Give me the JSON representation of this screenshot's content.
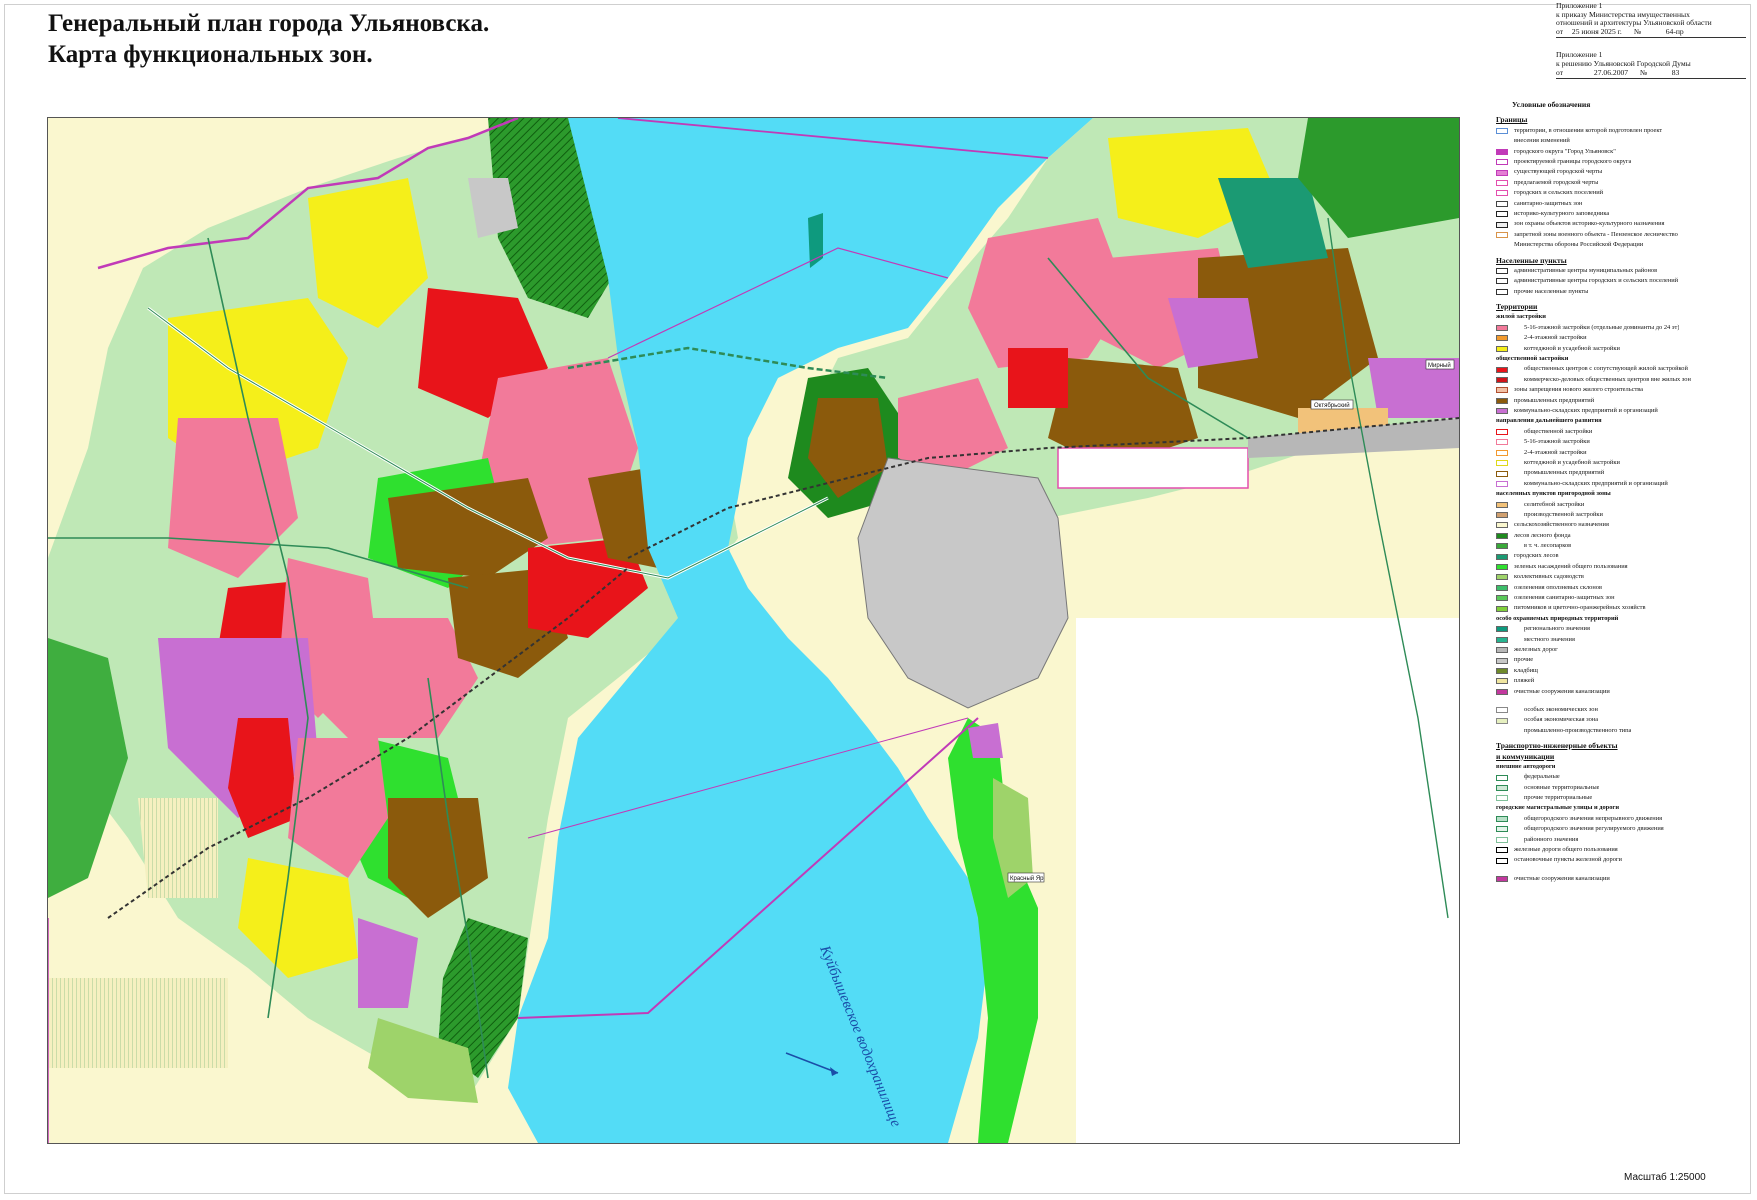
{
  "title": {
    "line1": "Генеральный план города Ульяновска.",
    "line2": "Карта функциональных зон."
  },
  "attachments": [
    {
      "lines": [
        "Приложение 1",
        "к приказу Министерства имущественных",
        "отношений и архитектуры Ульяновской области"
      ],
      "sig_from": "от",
      "sig_date": "25 июня 2025 г.",
      "sig_no": "№",
      "sig_num": "64-пр"
    },
    {
      "lines": [
        "Приложение 1",
        "к решению Ульяновской Городской Думы"
      ],
      "sig_from": "от",
      "sig_date": "27.06.2007",
      "sig_no": "№",
      "sig_num": "83"
    }
  ],
  "legend": {
    "title": "Условные обозначения",
    "sections": [
      {
        "header": "Границы",
        "items": [
          {
            "label": "территории, в отношении которой подготовлен проект",
            "color": "#ffffff",
            "border": "#5b8fd6"
          },
          {
            "label": "внесения изменений",
            "color": null
          },
          {
            "label": "городского округа \"Город Ульяновск\"",
            "color": "#c13ab8",
            "border": "#c13ab8"
          },
          {
            "label": "проектируемой границы городского округа",
            "color": "#ffffff",
            "border": "#c13ab8"
          },
          {
            "label": "существующей городской черты",
            "color": "#e47fd4",
            "border": "#c13ab8"
          },
          {
            "label": "предлагаемой городской черты",
            "color": "#ffffff",
            "border": "#e34fae"
          },
          {
            "label": "городских и сельских поселений",
            "color": "#ffffff",
            "border": "#e34fae"
          },
          {
            "label": "санитарно-защитных зон",
            "color": "#ffffff",
            "border": "#444444"
          },
          {
            "label": "историко-культурного заповедника",
            "color": "#ffffff",
            "border": "#222222"
          },
          {
            "label": "зон охраны объектов историко-культурного назначения",
            "color": "#eeeeee",
            "border": "#222222"
          },
          {
            "label": "запретной зоны военного объекта - Пензенское лесничество",
            "color": "#ffffff",
            "border": "#d8944a"
          },
          {
            "label": "Министерства обороны Российской Федерации",
            "color": null
          }
        ]
      },
      {
        "header": "Населенные пункты",
        "items": [
          {
            "label": "административные центры муниципальных районов",
            "color": "#ffffff",
            "border": "#333333"
          },
          {
            "label": "административные центры городских и сельских поселений",
            "color": "#ffffff",
            "border": "#333333"
          },
          {
            "label": "прочие населенные пункты",
            "color": "#ffffff",
            "border": "#333333"
          }
        ]
      },
      {
        "header": "Территории",
        "items": [
          {
            "label": "жилой застройки",
            "sub": true
          },
          {
            "label": "5-16-этажной застройки (отдельные доминанты до 24 эт)",
            "color": "#f27a9a",
            "indent": true
          },
          {
            "label": "2-4-этажной застройки",
            "color": "#f29a2e",
            "indent": true
          },
          {
            "label": "коттеджной и усадебной застройки",
            "color": "#f5ef1a",
            "indent": true
          },
          {
            "label": "общественной застройки",
            "sub": true
          },
          {
            "label": "общественных центров с сопутствующей жилой застройкой",
            "color": "#e8141a",
            "indent": true
          },
          {
            "label": "коммерческо-деловых общественных центров вне жилых зон",
            "color": "#d0141a",
            "indent": true
          },
          {
            "label": "зоны запрещения нового жилого строительства",
            "color": "#f2c1a6",
            "border": "#b05030"
          },
          {
            "label": "промышленных предприятий",
            "color": "#8b5a0c"
          },
          {
            "label": "коммунально-складских предприятий и организаций",
            "color": "#c86fd2"
          },
          {
            "label": "направления дальнейшего развития",
            "sub": true
          },
          {
            "label": "общественной застройки",
            "color": "#ffffff",
            "border": "#e8141a",
            "indent": true
          },
          {
            "label": "5-16-этажной застройки",
            "color": "#ffffff",
            "border": "#f27a9a",
            "indent": true
          },
          {
            "label": "2-4-этажной застройки",
            "color": "#ffffff",
            "border": "#f29a2e",
            "indent": true
          },
          {
            "label": "коттеджной и усадебной застройки",
            "color": "#ffffff",
            "border": "#e0d81a",
            "indent": true
          },
          {
            "label": "промышленных предприятий",
            "color": "#ffffff",
            "border": "#8b5a0c",
            "indent": true
          },
          {
            "label": "коммунально-складских предприятий и организаций",
            "color": "#ffffff",
            "border": "#c86fd2",
            "indent": true
          },
          {
            "label": "населенных пунктов пригородной зоны",
            "sub": true
          },
          {
            "label": "селитебной застройки",
            "color": "#f2c27a",
            "indent": true
          },
          {
            "label": "производственной застройки",
            "color": "#d0a070",
            "indent": true
          },
          {
            "label": "сельскохозяйственного назначения",
            "color": "#faf7cf"
          },
          {
            "label": "лесов лесного фонда",
            "color": "#1e8a1e"
          },
          {
            "label": "в т. ч. лесопарков",
            "color": "#39a839",
            "indent": true
          },
          {
            "label": "городских лесов",
            "color": "#1b9a73"
          },
          {
            "label": "зеленых насаждений общего пользования",
            "color": "#2fe02f"
          },
          {
            "label": "коллективных садоводств",
            "color": "#9ed36a"
          },
          {
            "label": "озеленения оползневых склонов",
            "color": "#3dbd6a"
          },
          {
            "label": "озеленения санитарно-защитных зон",
            "color": "#5ac85a"
          },
          {
            "label": "питомников и цветочно-оранжерейных хозяйств",
            "color": "#7fcf3a"
          },
          {
            "label": "особо охраняемых природных территорий",
            "sub": true
          },
          {
            "label": "регионального значения",
            "color": "#0e9a7e",
            "indent": true
          },
          {
            "label": "местного значения",
            "color": "#26b38f",
            "indent": true
          },
          {
            "label": "железных дорог",
            "color": "#b7b7b7"
          },
          {
            "label": "прочие",
            "color": "#c8c8c8"
          },
          {
            "label": "кладбищ",
            "color": "#6f8a2a"
          },
          {
            "label": "пляжей",
            "color": "#f0e6a0"
          },
          {
            "label": "очистные сооружения канализации",
            "color": "#c2389e"
          },
          {
            "gap": true
          },
          {
            "label": "особых экономических зон",
            "color": "#ffffff",
            "border": "#888888",
            "indent": true
          },
          {
            "label": "особая экономическая зона",
            "color": "#e6f0c0",
            "border": "#888888",
            "indent": true
          },
          {
            "label": "промышленно-производственного типа",
            "color": null,
            "indent": true
          }
        ]
      },
      {
        "header": "Транспортно-инженерные объекты",
        "header2": "и коммуникации",
        "items": [
          {
            "label": "внешние автодороги",
            "sub": true
          },
          {
            "label": "федеральные",
            "color": "#ffffff",
            "border": "#2e8b57",
            "indent": true
          },
          {
            "label": "основные территориальные",
            "color": "#cfe8d6",
            "border": "#2e8b57",
            "indent": true
          },
          {
            "label": "прочие территориальные",
            "color": "#ffffff",
            "border": "#7fbf99",
            "indent": true
          },
          {
            "label": "городские магистральные улицы и дороги",
            "sub": true
          },
          {
            "label": "общегородского значения непрерывного движения",
            "color": "#b8e0c8",
            "border": "#2e8b57",
            "indent": true
          },
          {
            "label": "общегородского значения регулируемого движения",
            "color": "#e4f4ea",
            "border": "#2e8b57",
            "indent": true
          },
          {
            "label": "районного значения",
            "color": "#ffffff",
            "border": "#7fbf99",
            "indent": true
          },
          {
            "label": "железные дороги общего пользования",
            "color": "#ffffff",
            "border": "#000000"
          },
          {
            "label": "остановочные пункты железной дороги",
            "color": "#ffffff",
            "border": "#000000"
          },
          {
            "gap": true
          },
          {
            "label": "очистные сооружения канализации",
            "color": "#c2389e"
          }
        ]
      }
    ]
  },
  "map": {
    "water_label": "Куйбышевское водохранилище",
    "place_labels": [
      "Октябрьский",
      "Мирный",
      "Красный Яр"
    ],
    "colors": {
      "water": "#53dcf6",
      "agri": "#faf7cf",
      "residential": "#f27a9a",
      "cottage": "#f5ef1a",
      "public": "#e8141a",
      "industrial": "#8b5a0c",
      "warehouse": "#c86fd2",
      "forest": "#1e8a1e",
      "park": "#2fe02f",
      "city_forest": "#1b9a73",
      "gardens": "#9ed36a",
      "other": "#c8c8c8",
      "boundary": "#c13ab8"
    }
  },
  "scale": "Масштаб 1:25000"
}
